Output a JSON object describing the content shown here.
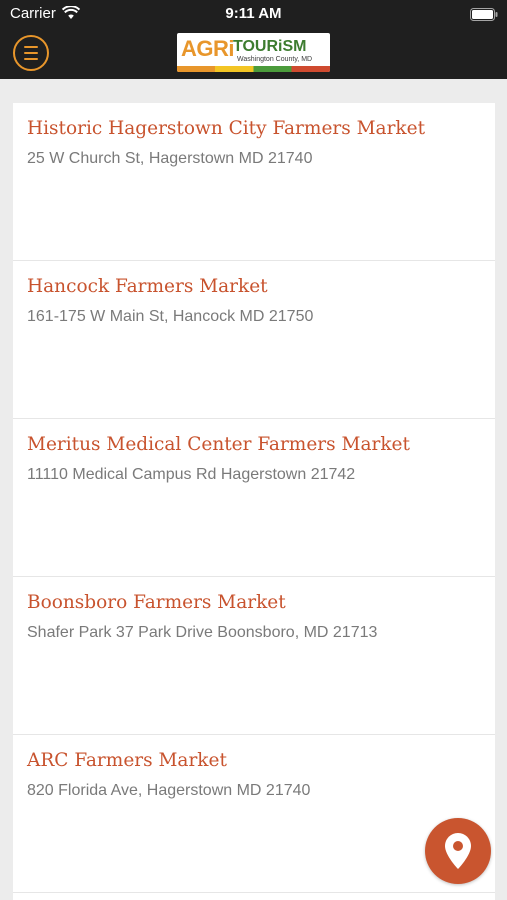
{
  "status_bar": {
    "carrier": "Carrier",
    "time": "9:11 AM"
  },
  "header": {
    "logo": {
      "agri": "AGRi",
      "tourism": "TOURiSM",
      "region": "Washington County, MD"
    },
    "icons": {
      "menu": "hamburger-menu-icon",
      "wifi": "wifi-icon",
      "battery": "battery-icon"
    }
  },
  "markets": [
    {
      "title": "Historic Hagerstown City Farmers Market",
      "address": "25 W Church St,  Hagerstown MD 21740"
    },
    {
      "title": "Hancock Farmers Market",
      "address": "161-175 W Main St,  Hancock MD 21750"
    },
    {
      "title": "Meritus Medical Center Farmers Market",
      "address": "11110 Medical Campus Rd Hagerstown 21742"
    },
    {
      "title": "Boonsboro Farmers Market",
      "address": "Shafer Park 37 Park Drive Boonsboro, MD 21713"
    },
    {
      "title": "ARC Farmers Market",
      "address": "820 Florida Ave,  Hagerstown MD 21740"
    }
  ],
  "fab": {
    "icon": "map-pin-icon"
  },
  "colors": {
    "header_bg": "#1f1f1f",
    "accent_orange": "#e8962b",
    "title_red": "#c8532e",
    "fab_bg": "#c9552f",
    "page_bg": "#ececec"
  }
}
